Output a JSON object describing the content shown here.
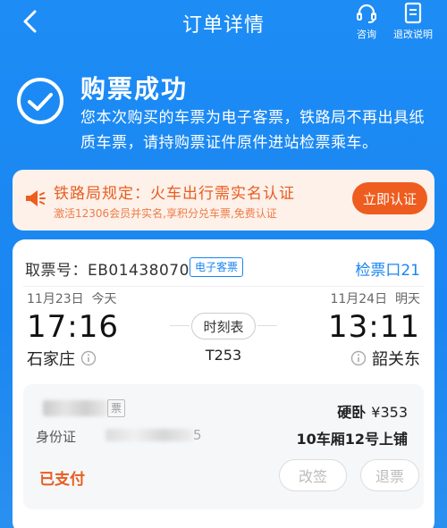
{
  "header": {
    "title": "订单详情",
    "consult_label": "咨询",
    "refund_label": "退改说明"
  },
  "status": {
    "title": "购票成功",
    "description": "您本次购买的车票为电子客票，铁路局不再出具纸质车票，请持购票证件原件进站检票乘车。"
  },
  "notice": {
    "title": "铁路局规定：火车出行需实名认证",
    "subtitle": "激活12306会员并实名,享积分兑车票,免费认证",
    "button_label": "立即认证",
    "accent_color": "#ee5d1f"
  },
  "ticket": {
    "pickup_label": "取票号：",
    "pickup_code": "EB01438070",
    "eticket_tag": "电子客票",
    "gate": "检票口21",
    "departure": {
      "date": "11月23日",
      "day_label": "今天",
      "time": "17:16",
      "station": "石家庄"
    },
    "arrival": {
      "date": "11月24日",
      "day_label": "明天",
      "time": "13:11",
      "station": "韶关东"
    },
    "schedule_label": "时刻表",
    "train_number": "T253"
  },
  "passenger": {
    "name_tag": "票",
    "seat_type": "硬卧",
    "price": "¥353",
    "id_label": "身份证",
    "id_tail": "5",
    "seat_position": "10车厢12号上铺",
    "payment_status": "已支付",
    "change_label": "改签",
    "refund_label": "退票"
  },
  "colors": {
    "primary": "#1a86f1",
    "orange": "#e85d1f"
  }
}
